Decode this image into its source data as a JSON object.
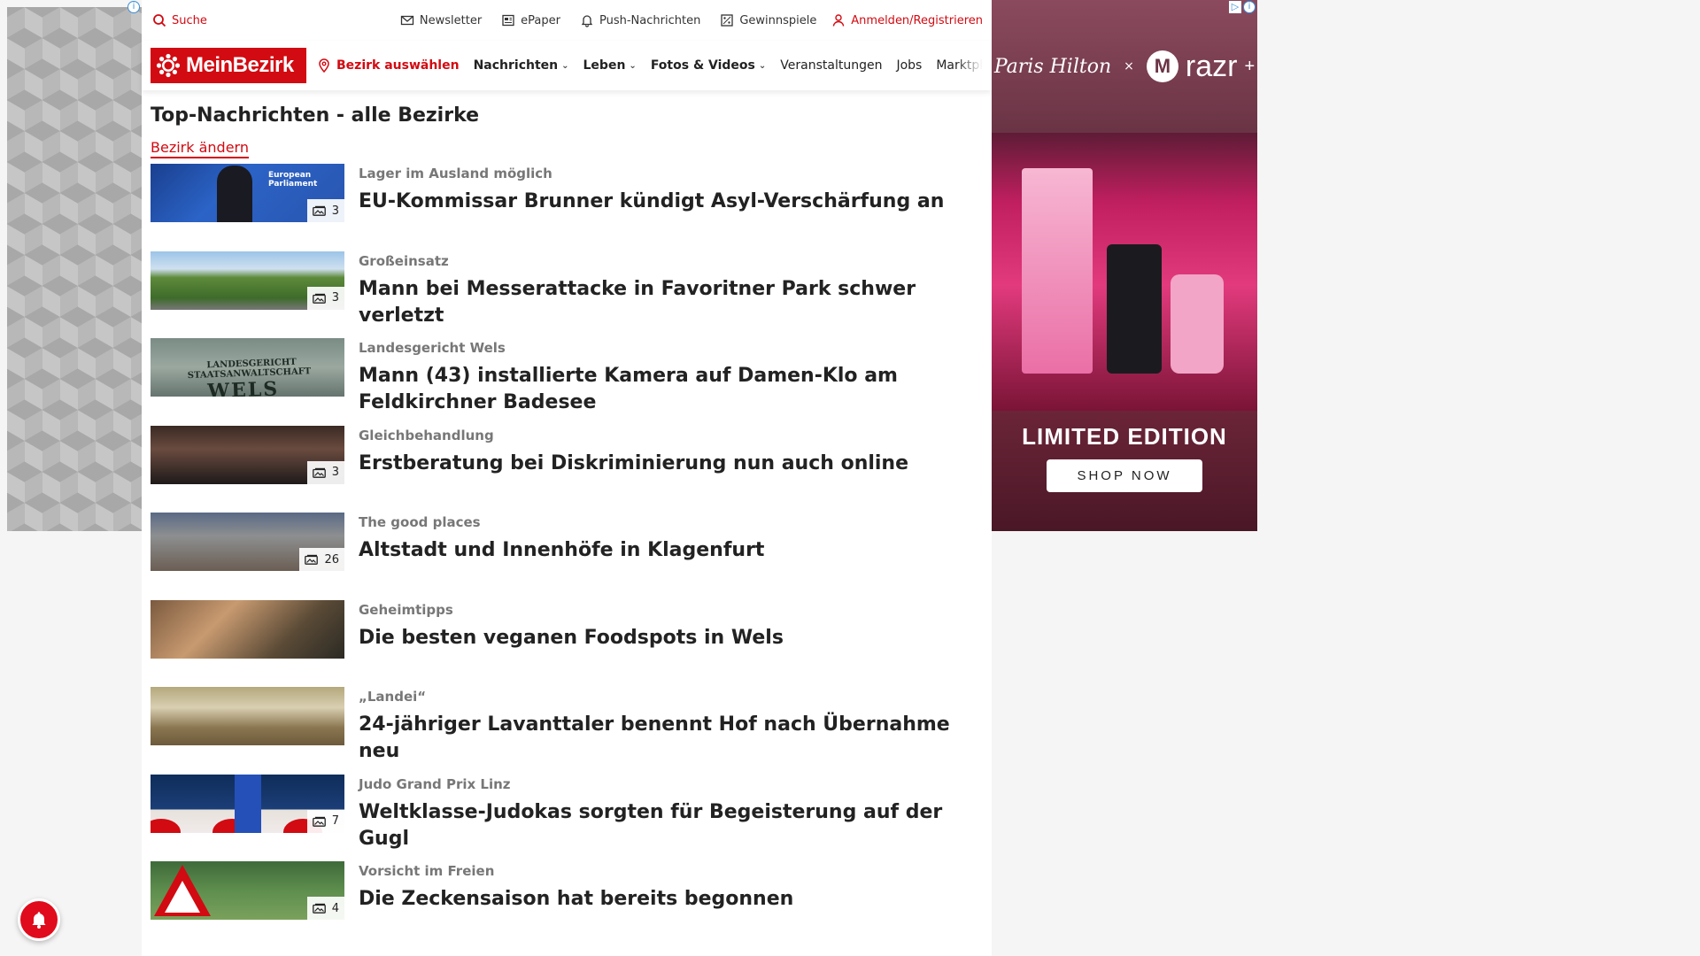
{
  "topbar": {
    "search_label": "Suche",
    "newsletter_label": "Newsletter",
    "epaper_label": "ePaper",
    "push_label": "Push-Nachrichten",
    "gewinnspiele_label": "Gewinnspiele",
    "login_label": "Anmelden/Registrieren"
  },
  "nav": {
    "logo_text": "MeinBezirk",
    "district_label": "Bezirk auswählen",
    "items": [
      {
        "label": "Nachrichten",
        "has_chevron": true
      },
      {
        "label": "Leben",
        "has_chevron": true
      },
      {
        "label": "Fotos & Videos",
        "has_chevron": true
      },
      {
        "label": "Veranstaltungen",
        "has_chevron": false
      },
      {
        "label": "Jobs",
        "has_chevron": false
      },
      {
        "label": "Marktplatz",
        "has_chevron": false
      }
    ]
  },
  "page": {
    "title": "Top-Nachrichten - alle Bezirke",
    "change_district": "Bezirk ändern"
  },
  "articles": [
    {
      "kicker": "Lager im Ausland möglich",
      "title": "EU-Kommissar Brunner kündigt Asyl-Verschärfung an",
      "photo_count": "3"
    },
    {
      "kicker": "Großeinsatz",
      "title": "Mann bei Messerattacke in Favoritner Park schwer verletzt",
      "photo_count": "3"
    },
    {
      "kicker": "Landesgericht Wels",
      "title": "Mann (43) installierte Kamera auf Damen-Klo am Feldkirchner Badesee",
      "photo_count": ""
    },
    {
      "kicker": "Gleichbehandlung",
      "title": "Erstberatung bei Diskriminierung nun auch online",
      "photo_count": "3"
    },
    {
      "kicker": "The good places",
      "title": "Altstadt und Innenhöfe in Klagenfurt",
      "photo_count": "26"
    },
    {
      "kicker": "Geheimtipps",
      "title": "Die besten veganen Foodspots in Wels",
      "photo_count": ""
    },
    {
      "kicker": "„Landei“",
      "title": "24-jähriger Lavanttaler benennt Hof nach Übernahme neu",
      "photo_count": ""
    },
    {
      "kicker": "Judo Grand Prix Linz",
      "title": "Weltklasse-Judokas sorgten für Begeisterung auf der Gugl",
      "photo_count": "7"
    },
    {
      "kicker": "Vorsicht im Freien",
      "title": "Die Zeckensaison hat bereits begonnen",
      "photo_count": "4"
    }
  ],
  "thumb_texts": {
    "eu_banner": "European Parliament",
    "court_sign_line1": "LANDESGERICHT",
    "court_sign_line2": "STAATSANWALTSCHAFT",
    "court_sign_line3": "WELS"
  },
  "right_ad": {
    "brand_script": "Paris Hilton",
    "cross": "×",
    "brand_logo": "M",
    "product": "razr",
    "product_sup": "+",
    "headline": "LIMITED EDITION",
    "cta": "SHOP NOW"
  },
  "colors": {
    "brand_red": "#d20a11",
    "text_dark": "#222222",
    "kicker_gray": "#777777"
  },
  "icons": [
    "search-icon",
    "mail-icon",
    "newspaper-icon",
    "bell-icon",
    "gift-icon",
    "user-icon",
    "location-pin-icon",
    "chevron-down-icon",
    "camera-icon",
    "ad-info-icon",
    "notification-bell-icon"
  ]
}
